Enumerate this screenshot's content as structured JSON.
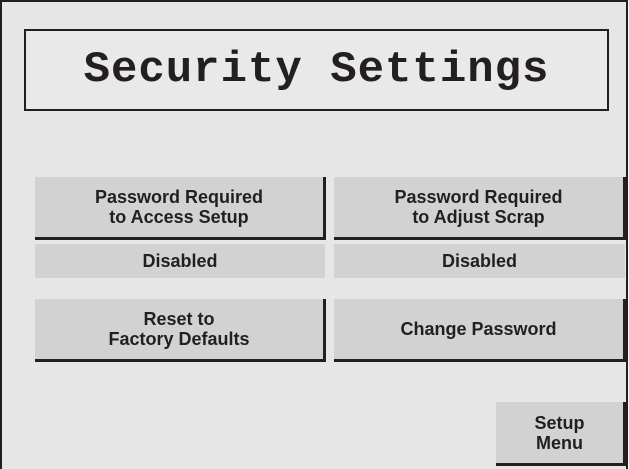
{
  "title": "Security Settings",
  "buttons": {
    "access_setup": "Password Required\nto Access Setup",
    "adjust_scrap": "Password Required\nto Adjust Scrap",
    "reset_defaults": "Reset to\nFactory Defaults",
    "change_password": "Change Password",
    "setup_menu": "Setup\nMenu"
  },
  "status": {
    "access_setup": "Disabled",
    "adjust_scrap": "Disabled"
  },
  "colors": {
    "background": "#e6e6e6",
    "button": "#d2d2d2",
    "border": "#231f20"
  }
}
